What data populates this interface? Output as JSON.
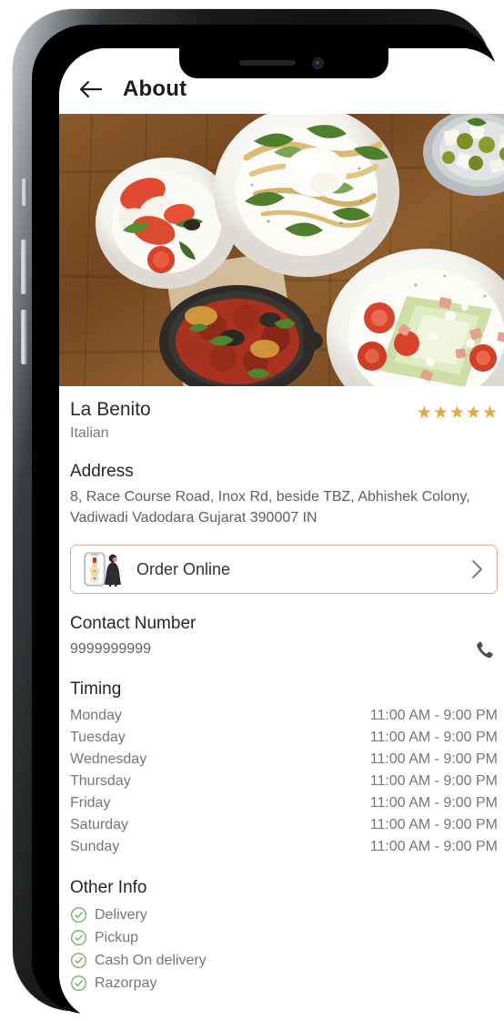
{
  "app_bar": {
    "title": "About",
    "back_icon": "arrow-left-icon"
  },
  "hero": {
    "alt": "flat-lay of italian dishes on a wooden table"
  },
  "restaurant": {
    "name": "La Benito",
    "cuisine": "Italian",
    "rating": 5,
    "rating_stars": [
      "★",
      "★",
      "★",
      "★",
      "★"
    ],
    "star_color": "#e9a63c"
  },
  "address": {
    "heading": "Address",
    "value": "8, Race Course Road, Inox Rd, beside TBZ, Abhishek Colony, Vadiwadi Vadodara Gujarat 390007 IN"
  },
  "order_online": {
    "label": "Order Online",
    "icon": "phone-order-illustration-icon",
    "chevron": "chevron-right-icon",
    "border_color": "#e2a98b"
  },
  "contact": {
    "heading": "Contact Number",
    "number": "9999999999",
    "call_icon": "phone-handset-icon"
  },
  "timing": {
    "heading": "Timing",
    "rows": [
      {
        "day": "Monday",
        "hours": "11:00 AM - 9:00 PM"
      },
      {
        "day": "Tuesday",
        "hours": "11:00 AM - 9:00 PM"
      },
      {
        "day": "Wednesday",
        "hours": "11:00 AM - 9:00 PM"
      },
      {
        "day": "Thursday",
        "hours": "11:00 AM - 9:00 PM"
      },
      {
        "day": "Friday",
        "hours": "11:00 AM - 9:00 PM"
      },
      {
        "day": "Saturday",
        "hours": "11:00 AM - 9:00 PM"
      },
      {
        "day": "Sunday",
        "hours": "11:00 AM - 9:00 PM"
      }
    ]
  },
  "other_info": {
    "heading": "Other Info",
    "items": [
      {
        "label": "Delivery"
      },
      {
        "label": "Pickup"
      },
      {
        "label": "Cash On delivery"
      },
      {
        "label": "Razorpay"
      }
    ],
    "check_color": "#6aa84f"
  }
}
